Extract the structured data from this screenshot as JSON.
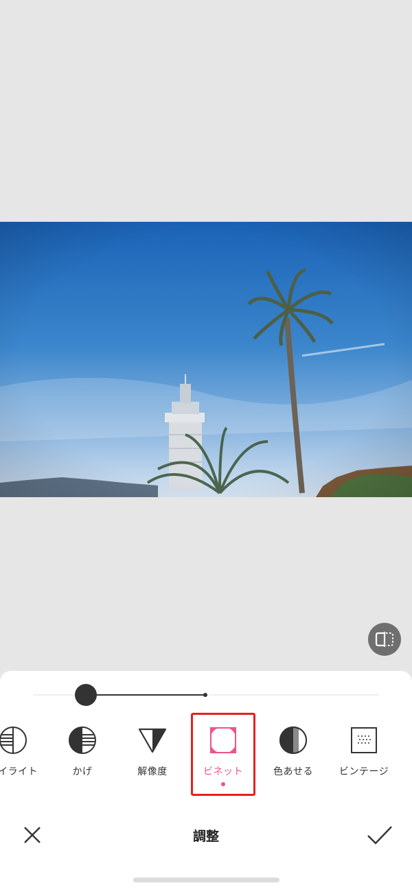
{
  "photo": {
    "icon": "photo-image"
  },
  "compare": {
    "icon": "compare-icon"
  },
  "slider": {
    "value_fraction": 0.15
  },
  "tools": [
    {
      "label": "ハイライト",
      "icon": "highlight-icon"
    },
    {
      "label": "かげ",
      "icon": "shadow-icon"
    },
    {
      "label": "解像度",
      "icon": "sharpness-icon"
    },
    {
      "label": "ビネット",
      "icon": "vignette-icon",
      "active": true
    },
    {
      "label": "色あせる",
      "icon": "fade-icon"
    },
    {
      "label": "ビンテージ",
      "icon": "vintage-icon"
    }
  ],
  "bottom": {
    "title": "調整",
    "close_icon": "close-icon",
    "confirm_icon": "checkmark-icon"
  },
  "colors": {
    "accent": "#f0528a",
    "highlight_box": "#e5201d"
  }
}
